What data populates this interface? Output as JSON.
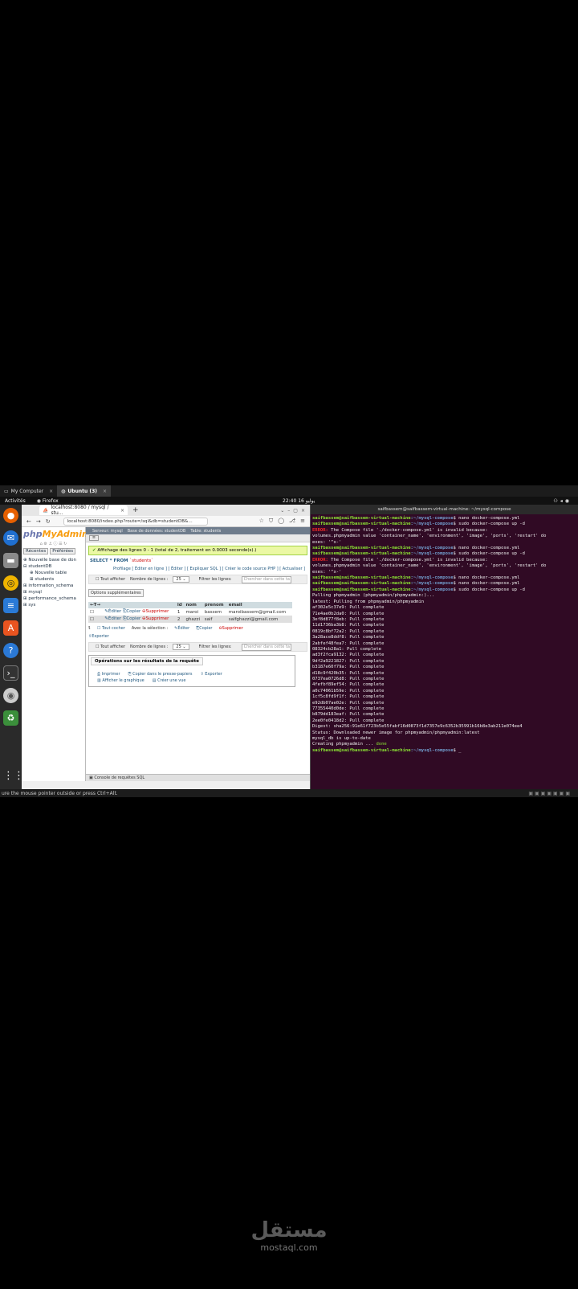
{
  "vm_tabs": [
    {
      "icon": "monitor-icon",
      "label": "My Computer"
    },
    {
      "icon": "ubuntu-icon",
      "label": "Ubuntu (3)"
    }
  ],
  "topbar": {
    "activities": "Activités",
    "app": "Firefox",
    "clock": "22:40 16 يوليو"
  },
  "firefox": {
    "tab_title": "localhost:8080 / mysql / stu…",
    "url": "localhost:8080/index.php?route=/sql&db=studentDB&…",
    "pma": {
      "logo_php": "php",
      "logo_my": "MyAdmin",
      "side_tabs": [
        "Récentes",
        "Préférées"
      ],
      "tree": [
        "Nouvelle base de don",
        "studentDB",
        "Nouvelle table",
        "students",
        "information_schema",
        "mysql",
        "performance_schema",
        "sys"
      ],
      "breadcrumb": [
        "Serveur: mysql",
        "Base de données: studentDB",
        "Table: students"
      ],
      "success": "Affichage des lignes 0 - 1 (total de 2, traitement en 0.0003 seconde(s).)",
      "sql_kw": "SELECT * FROM",
      "sql_table": "`students`",
      "profil": "Profilage [ Éditer en ligne ] [ Éditer ] [ Expliquer SQL ] [ Créer le code source PHP ] [ Actualiser ]",
      "nav": {
        "show_all": "Tout afficher",
        "rows_label": "Nombre de lignes :",
        "rows_value": "25",
        "filter_label": "Filtrer les lignes:",
        "filter_placeholder": "Chercher dans cette ta"
      },
      "options": "Options supplémentaires",
      "columns": [
        "←T→",
        "",
        "id",
        "nom",
        "prenom",
        "email"
      ],
      "rows": [
        {
          "edit": "Éditer",
          "copy": "Copier",
          "del": "Supprimer",
          "id": "1",
          "nom": "maroi",
          "prenom": "bassem",
          "email": "maroibassem@gmail.com"
        },
        {
          "edit": "Éditer",
          "copy": "Copier",
          "del": "Supprimer",
          "id": "2",
          "nom": "ghazzi",
          "prenom": "saif",
          "email": "saifghazzi@gmail.com"
        }
      ],
      "bulk": {
        "check_all": "Tout cocher",
        "with_sel": "Avec la sélection :",
        "edit": "Éditer",
        "copy": "Copier",
        "del": "Supprimer",
        "export": "Exporter"
      },
      "ops": {
        "title": "Opérations sur les résultats de la requête",
        "print": "Imprimer",
        "clipboard": "Copier dans le presse-papiers",
        "export": "Exporter",
        "chart": "Afficher le graphique",
        "view": "Créer une vue"
      },
      "console": "Console de requêtes SQL"
    }
  },
  "terminal": {
    "title": "saifbassem@saifbassem-virtual-machine: ~/mysql-compose",
    "user": "saifbassem@saifbassem-virtual-machine",
    "path": ":~/mysql-compose",
    "lines": [
      {
        "t": "p",
        "c": "nano docker-compose.yml"
      },
      {
        "t": "p",
        "c": "sudo docker-compose up -d"
      },
      {
        "t": "e",
        "c": " The Compose file './docker-compose.yml' is invalid because:"
      },
      {
        "t": "o",
        "c": "volumes.phpmyadmin value 'container_name', 'environment', 'image', 'ports', 'restart' do"
      },
      {
        "t": "o",
        "c": "exes: '^x-'"
      },
      {
        "t": "p",
        "c": "nano docker-compose.yml"
      },
      {
        "t": "p",
        "c": "sudo docker-compose up -d"
      },
      {
        "t": "e",
        "c": " The Compose file './docker-compose.yml' is invalid because:"
      },
      {
        "t": "o",
        "c": "volumes.phpmyadmin value 'container_name', 'environment', 'image', 'ports', 'restart' do"
      },
      {
        "t": "o",
        "c": "exes: '^x-'"
      },
      {
        "t": "p",
        "c": "nano docker-compose.yml"
      },
      {
        "t": "p",
        "c": "nano docker-compose.yml"
      },
      {
        "t": "p",
        "c": "sudo docker-compose up -d"
      },
      {
        "t": "o",
        "c": "Pulling phpmyadmin (phpmyadmin/phpmyadmin:)..."
      },
      {
        "t": "o",
        "c": "latest: Pulling from phpmyadmin/phpmyadmin"
      },
      {
        "t": "o",
        "c": "af302e5c37e9: Pull complete"
      },
      {
        "t": "o",
        "c": "71e4ae0b2da0: Pull complete"
      },
      {
        "t": "o",
        "c": "3ef8d877f8eb: Pull complete"
      },
      {
        "t": "o",
        "c": "11d1736ba3b8: Pull complete"
      },
      {
        "t": "o",
        "c": "0819c8bf72a2: Pull complete"
      },
      {
        "t": "o",
        "c": "3a28ace8ddf8: Pull complete"
      },
      {
        "t": "o",
        "c": "2abfef48fea7: Pull complete"
      },
      {
        "t": "o",
        "c": "08324cb28a1: Pull complete"
      },
      {
        "t": "o",
        "c": "ad3f2fca9132: Pull complete"
      },
      {
        "t": "o",
        "c": "9df2a9221827: Pull complete"
      },
      {
        "t": "o",
        "c": "b3187e60f79a: Pull complete"
      },
      {
        "t": "o",
        "c": "d18c9f420b35: Pull complete"
      },
      {
        "t": "o",
        "c": "0737ea0726d8: Pull complete"
      },
      {
        "t": "o",
        "c": "4fefbf89ef54: Pull complete"
      },
      {
        "t": "o",
        "c": "a0c74061b59e: Pull complete"
      },
      {
        "t": "o",
        "c": "1cf5c8fd9f1f: Pull complete"
      },
      {
        "t": "o",
        "c": "e92db07ae02e: Pull complete"
      },
      {
        "t": "o",
        "c": "77355440d0de: Pull complete"
      },
      {
        "t": "o",
        "c": "b879dd183eaf: Pull complete"
      },
      {
        "t": "o",
        "c": "2ee0fe0418d2: Pull complete"
      },
      {
        "t": "o",
        "c": "Digest: sha256:91e61f723b5e55fabf16d0873f1d7357e9c6352b35991b16b8e3ab211e074ee4"
      },
      {
        "t": "o",
        "c": "Status: Downloaded newer image for phpmyadmin/phpmyadmin:latest"
      },
      {
        "t": "o",
        "c": "mysql_db is up-to-date"
      },
      {
        "t": "d",
        "c": "Creating phpmyadmin ... "
      },
      {
        "t": "p",
        "c": "_"
      }
    ],
    "error_label": "ERROR:",
    "done": "done"
  },
  "status_text": "ure the mouse pointer outside or press Ctrl+Alt.",
  "watermark": {
    "arabic": "مستقل",
    "latin": "mostaql.com"
  }
}
